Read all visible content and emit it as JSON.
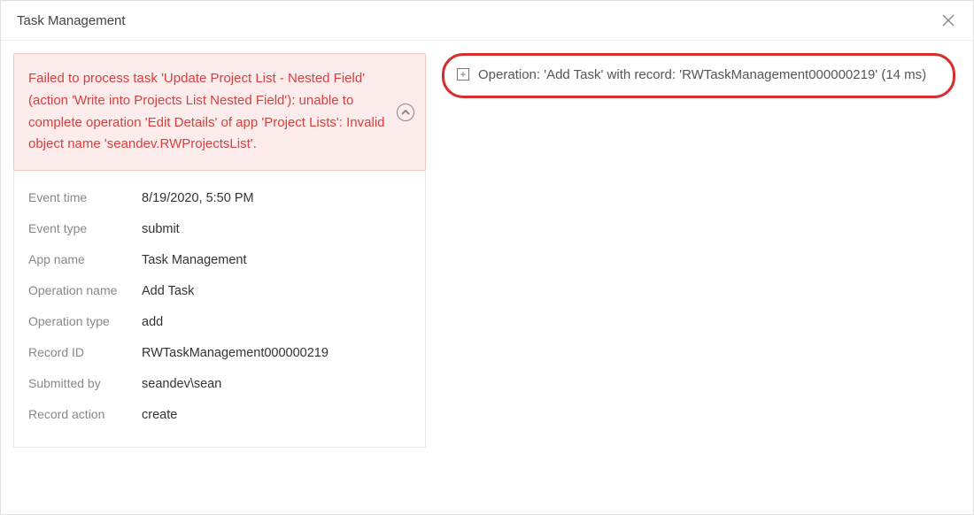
{
  "header": {
    "title": "Task Management"
  },
  "error": {
    "message": "Failed to process task 'Update Project List - Nested Field' (action 'Write into Projects List Nested Field'): unable to complete operation 'Edit Details' of app 'Project Lists': Invalid object name 'seandev.RWProjectsList'."
  },
  "details": {
    "rows": [
      {
        "label": "Event time",
        "value": "8/19/2020, 5:50 PM"
      },
      {
        "label": "Event type",
        "value": "submit"
      },
      {
        "label": "App name",
        "value": "Task Management"
      },
      {
        "label": "Operation name",
        "value": "Add Task"
      },
      {
        "label": "Operation type",
        "value": "add"
      },
      {
        "label": "Record ID",
        "value": "RWTaskManagement000000219"
      },
      {
        "label": "Submitted by",
        "value": "seandev\\sean"
      },
      {
        "label": "Record action",
        "value": "create"
      }
    ]
  },
  "operation": {
    "text": "Operation: 'Add Task' with record: 'RWTaskManagement000000219' (14 ms)"
  }
}
